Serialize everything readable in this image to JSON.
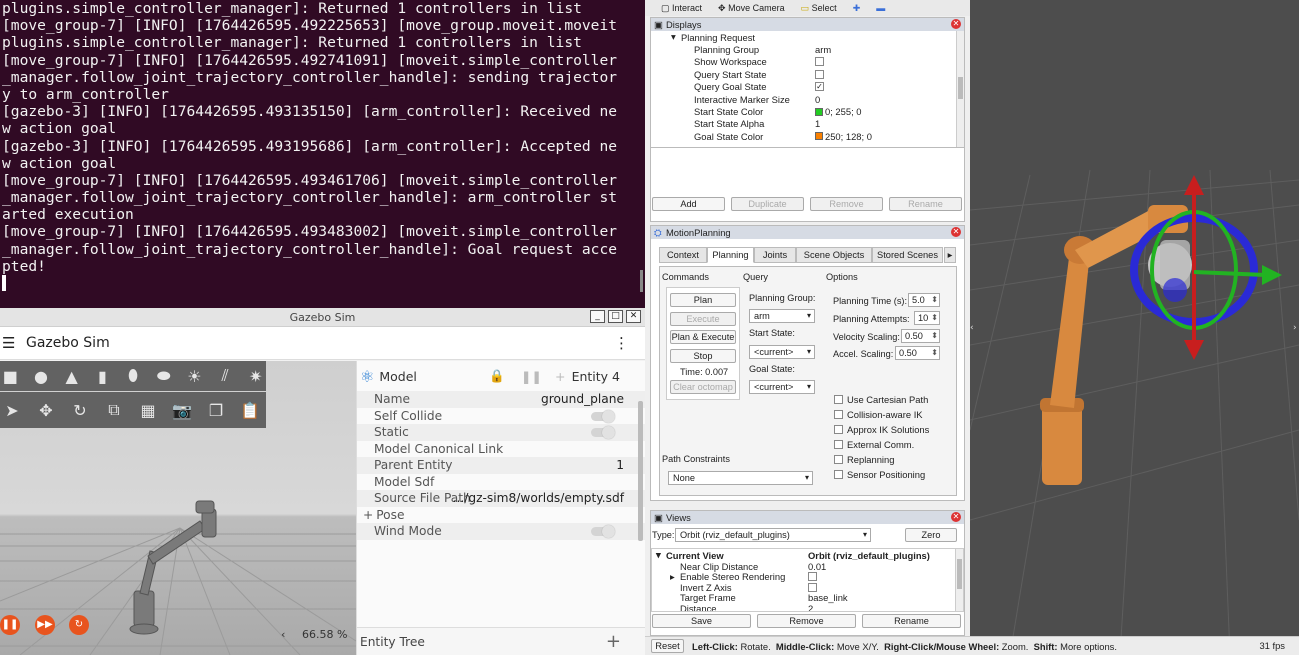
{
  "terminal": {
    "lines": [
      "plugins.simple_controller_manager]: Returned 1 controllers in list",
      "[move_group-7] [INFO] [1764426595.492225653] [move_group.moveit.moveit",
      "plugins.simple_controller_manager]: Returned 1 controllers in list",
      "[move_group-7] [INFO] [1764426595.492741091] [moveit.simple_controller",
      "_manager.follow_joint_trajectory_controller_handle]: sending trajector",
      "y to arm_controller",
      "[gazebo-3] [INFO] [1764426595.493135150] [arm_controller]: Received ne",
      "w action goal",
      "[gazebo-3] [INFO] [1764426595.493195686] [arm_controller]: Accepted ne",
      "w action goal",
      "[move_group-7] [INFO] [1764426595.493461706] [moveit.simple_controller",
      "_manager.follow_joint_trajectory_controller_handle]: arm_controller st",
      "arted execution",
      "[move_group-7] [INFO] [1764426595.493483002] [moveit.simple_controller",
      "_manager.follow_joint_trajectory_controller_handle]: Goal request acce",
      "pted!"
    ]
  },
  "gazebo": {
    "window_title": "Gazebo Sim",
    "app_title": "Gazebo Sim",
    "zoom": "66.58 %",
    "component_header": {
      "label": "Model",
      "entity": "Entity 4"
    },
    "rows": {
      "name": {
        "label": "Name",
        "value": "ground_plane"
      },
      "self_collide": {
        "label": "Self Collide"
      },
      "static": {
        "label": "Static"
      },
      "canonical": {
        "label": "Model Canonical Link"
      },
      "parent": {
        "label": "Parent Entity",
        "value": "1"
      },
      "sdf": {
        "label": "Model Sdf"
      },
      "source": {
        "label": "Source File Path",
        "value": ".../gz-sim8/worlds/empty.sdf"
      },
      "pose": {
        "label": "Pose"
      },
      "wind": {
        "label": "Wind Mode"
      }
    },
    "entity_tree": "Entity Tree"
  },
  "rviz": {
    "toolbar": {
      "interact": "Interact",
      "move_camera": "Move Camera",
      "select": "Select"
    },
    "displays": {
      "title": "Displays",
      "group": "Planning Request",
      "props": [
        {
          "label": "Planning Group",
          "value": "arm"
        },
        {
          "label": "Show Workspace",
          "value": ""
        },
        {
          "label": "Query Start State",
          "value": ""
        },
        {
          "label": "Query Goal State",
          "value": "✓"
        },
        {
          "label": "Interactive Marker Size",
          "value": "0"
        },
        {
          "label": "Start State Color",
          "value": "0; 255; 0"
        },
        {
          "label": "Start State Alpha",
          "value": "1"
        },
        {
          "label": "Goal State Color",
          "value": "250; 128; 0"
        }
      ],
      "start_color": "#22cc22",
      "goal_color": "#fa8000",
      "buttons": {
        "add": "Add",
        "duplicate": "Duplicate",
        "remove": "Remove",
        "rename": "Rename"
      }
    },
    "motion": {
      "title": "MotionPlanning",
      "tabs": [
        "Context",
        "Planning",
        "Joints",
        "Scene Objects",
        "Stored Scenes"
      ],
      "commands_label": "Commands",
      "query_label": "Query",
      "options_label": "Options",
      "plan": "Plan",
      "execute": "Execute",
      "plan_execute": "Plan & Execute",
      "stop": "Stop",
      "time": "Time: 0.007",
      "clear_octomap": "Clear octomap",
      "planning_group_label": "Planning Group:",
      "planning_group": "arm",
      "start_state_label": "Start State:",
      "start_state": "<current>",
      "goal_state_label": "Goal State:",
      "goal_state": "<current>",
      "planning_time_label": "Planning Time (s):",
      "planning_time": "5.0",
      "planning_attempts_label": "Planning Attempts:",
      "planning_attempts": "10",
      "velocity_label": "Velocity Scaling:",
      "velocity": "0.50",
      "accel_label": "Accel. Scaling:",
      "accel": "0.50",
      "checkboxes": [
        "Use Cartesian Path",
        "Collision-aware IK",
        "Approx IK Solutions",
        "External Comm.",
        "Replanning",
        "Sensor Positioning"
      ],
      "path_constraints_label": "Path Constraints",
      "path_constraints": "None"
    },
    "views": {
      "title": "Views",
      "type_label": "Type:",
      "type": "Orbit (rviz_default_plugins)",
      "zero": "Zero",
      "current_view": "Current View",
      "current_view_value": "Orbit (rviz_default_plugins)",
      "props": [
        {
          "label": "Near Clip Distance",
          "value": "0.01"
        },
        {
          "label": "Enable Stereo Rendering",
          "value": ""
        },
        {
          "label": "Invert Z Axis",
          "value": ""
        },
        {
          "label": "Target Frame",
          "value": "base_link"
        },
        {
          "label": "Distance",
          "value": "2"
        }
      ],
      "save": "Save",
      "remove": "Remove",
      "rename": "Rename"
    },
    "status": {
      "reset": "Reset",
      "left_click": "Left-Click:",
      "left_click_text": " Rotate. ",
      "middle_click": "Middle-Click:",
      "middle_click_text": " Move X/Y. ",
      "right_click": "Right-Click/Mouse Wheel:",
      "right_click_text": " Zoom. ",
      "shift": "Shift:",
      "shift_text": " More options.",
      "fps": "31 fps"
    }
  }
}
